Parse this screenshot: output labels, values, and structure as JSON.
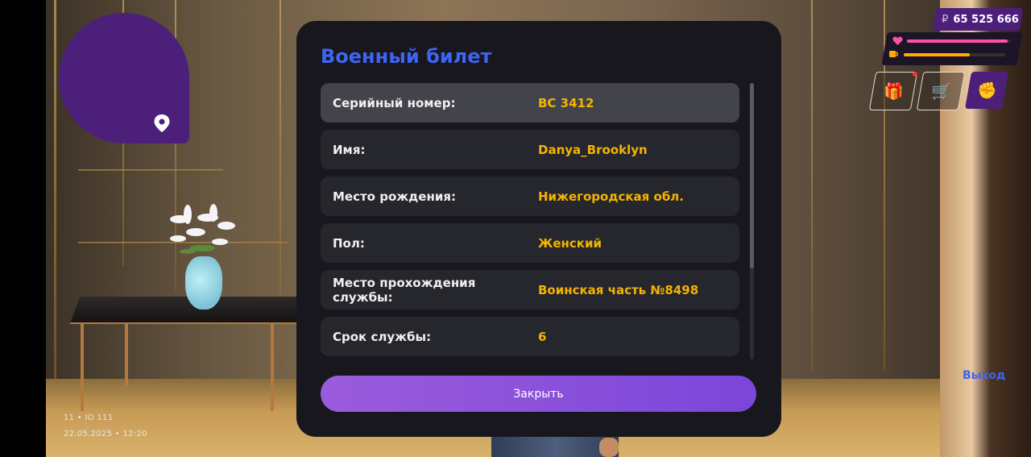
{
  "hud": {
    "money": "65 525 666",
    "currency_symbol": "₽",
    "exit_label": "Выход",
    "health_icon": "heart-icon",
    "hunger_icon": "cup-icon",
    "health_level": 0.98,
    "hunger_level": 0.65,
    "gift_icon": "gift-icon",
    "cart_icon": "cart-icon",
    "fist_icon": "fist-icon",
    "colors": {
      "accent_purple": "#4c1f7a",
      "health": "#ff4fa3",
      "hunger": "#ffae00"
    }
  },
  "minimap": {
    "pin_icon": "location-pin-icon"
  },
  "server_info": {
    "line1": "11 • IO 111",
    "datetime": "22.05.2025 • 12:20"
  },
  "modal": {
    "title": "Военный билет",
    "rows": [
      {
        "label": "Серийный номер:",
        "value": "ВС 3412"
      },
      {
        "label": "Имя:",
        "value": "Danya_Brooklyn"
      },
      {
        "label": "Место рождения:",
        "value": "Нижегородская обл."
      },
      {
        "label": "Пол:",
        "value": "Женский"
      },
      {
        "label": "Место прохождения службы:",
        "value": "Воинская часть №8498"
      },
      {
        "label": "Срок службы:",
        "value": "6"
      }
    ],
    "close_label": "Закрыть",
    "colors": {
      "title": "#3f64f0",
      "value": "#f4b400",
      "button": "#8a52da"
    }
  }
}
